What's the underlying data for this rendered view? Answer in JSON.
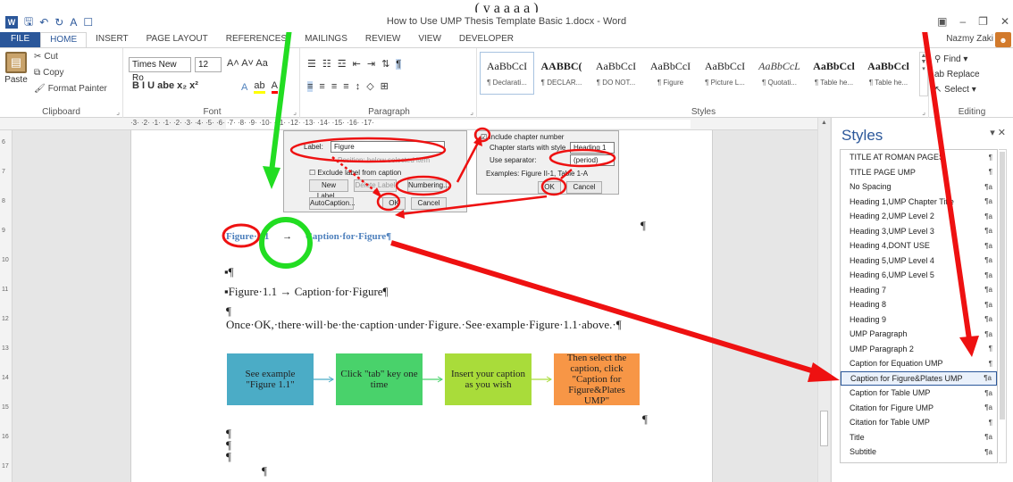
{
  "banner": {
    "text": "(                                     y     a       a   a   a  )"
  },
  "app": {
    "title": "How to Use UMP Thesis Template Basic 1.docx - Word",
    "logo": "W",
    "user": "Nazmy Zaki",
    "quick_access": [
      "save-icon",
      "undo-icon",
      "redo-icon",
      "font-icon",
      "touch-icon"
    ]
  },
  "tabs": [
    "FILE",
    "HOME",
    "INSERT",
    "PAGE LAYOUT",
    "REFERENCES",
    "MAILINGS",
    "REVIEW",
    "VIEW",
    "DEVELOPER"
  ],
  "ribbon": {
    "clipboard": {
      "paste": "Paste",
      "cut": "Cut",
      "copy": "Copy",
      "format_painter": "Format Painter",
      "label": "Clipboard"
    },
    "font": {
      "name": "Times New Ro",
      "size": "12",
      "row1": "A˄ A˅ Aa",
      "row2": "B I U abe x₂ x²",
      "label": "Font"
    },
    "paragraph": {
      "label": "Paragraph"
    },
    "styles": {
      "label": "Styles",
      "gallery": [
        {
          "sample": "AaBbCcI",
          "name": "¶ Declarati..."
        },
        {
          "sample": "AABBC(",
          "name": "¶ DECLAR..."
        },
        {
          "sample": "AaBbCcI",
          "name": "¶ DO NOT..."
        },
        {
          "sample": "AaBbCcI",
          "name": "¶ Figure"
        },
        {
          "sample": "AaBbCcI",
          "name": "¶ Picture L..."
        },
        {
          "sample": "AaBbCcL",
          "name": "¶ Quotati..."
        },
        {
          "sample": "AaBbCcl",
          "name": "¶ Table he..."
        },
        {
          "sample": "AaBbCcl",
          "name": "¶ Table he..."
        }
      ]
    },
    "editing": {
      "find": "Find",
      "replace": "Replace",
      "select": "Select",
      "label": "Editing"
    }
  },
  "ruler": {
    "marks": "·3·  ·2·  ·1·     ·1·  ·2·  ·3·  ·4·  ·5·  ·6·  ·7·  ·8·  ·9·  ·10·  ·11·  ·12·  ·13·  ·14·  ·15·  ·16·  ·17·",
    "vmarks": [
      "6",
      "7",
      "8",
      "9",
      "10",
      "11",
      "12",
      "13",
      "14",
      "15",
      "16",
      "17"
    ]
  },
  "caption_dialog": {
    "label_caption": "Label:",
    "label_value": "Figure",
    "position_hint": "Position: below selected item",
    "exclude": "Exclude label from caption",
    "new_label": "New Label...",
    "delete_label": "Delete Label",
    "numbering": "Numbering...",
    "autocaption": "AutoCaption...",
    "ok": "OK",
    "cancel": "Cancel"
  },
  "numbering_dialog": {
    "include": "Include chapter number",
    "starts": "Chapter starts with style",
    "starts_value": "Heading 1",
    "separator": "Use separator:",
    "separator_value": "(period)",
    "examples": "Examples:  Figure II-1, Table 1-A",
    "ok": "OK",
    "cancel": "Cancel"
  },
  "document": {
    "caption_number": "Figure·1.1",
    "tab_arrow": "→",
    "caption_text": "Caption·for·Figure¶",
    "pilcrow": "¶",
    "bullet_pilcrow": "▪¶",
    "line_caption": "▪Figure·1.1 → Caption·for·Figure¶",
    "instruction": "Once·OK,·there·will·be·the·caption·under·Figure.·See·example·Figure·1.1·above.·¶",
    "flow": [
      {
        "text": "See example \"Figure 1.1\"",
        "color": "#4bacc6"
      },
      {
        "text": "Click \"tab\" key one time",
        "color": "#49d26b"
      },
      {
        "text": "Insert your caption as you wish",
        "color": "#a9dc3a"
      },
      {
        "text": "Then select the caption, click \"Caption for Figure&Plates UMP\"",
        "color": "#f79646"
      }
    ]
  },
  "styles_pane": {
    "title": "Styles",
    "items": [
      {
        "name": "TITLE AT ROMAN PAGES",
        "type": "¶"
      },
      {
        "name": "TITLE PAGE UMP",
        "type": "¶"
      },
      {
        "name": "No Spacing",
        "type": "¶a"
      },
      {
        "name": "Heading 1,UMP Chapter Title",
        "type": "¶a"
      },
      {
        "name": "Heading 2,UMP Level 2",
        "type": "¶a"
      },
      {
        "name": "Heading 3,UMP Level 3",
        "type": "¶a"
      },
      {
        "name": "Heading 4,DONT USE",
        "type": "¶a"
      },
      {
        "name": "Heading 5,UMP Level 4",
        "type": "¶a"
      },
      {
        "name": "Heading 6,UMP Level 5",
        "type": "¶a"
      },
      {
        "name": "Heading 7",
        "type": "¶a"
      },
      {
        "name": "Heading 8",
        "type": "¶a"
      },
      {
        "name": "Heading 9",
        "type": "¶a"
      },
      {
        "name": "UMP Paragraph",
        "type": "¶a"
      },
      {
        "name": "UMP Paragraph 2",
        "type": "¶"
      },
      {
        "name": "Caption for Equation UMP",
        "type": "¶"
      },
      {
        "name": "Caption for Figure&Plates UMP",
        "type": "¶a",
        "selected": true
      },
      {
        "name": "Caption for Table UMP",
        "type": "¶a"
      },
      {
        "name": "Citation for Figure UMP",
        "type": "¶a"
      },
      {
        "name": "Citation for Table UMP",
        "type": "¶"
      },
      {
        "name": "Title",
        "type": "¶a"
      },
      {
        "name": "Subtitle",
        "type": "¶a"
      }
    ]
  },
  "annotation_colors": {
    "green": "#22dd22",
    "red": "#ee1111"
  }
}
